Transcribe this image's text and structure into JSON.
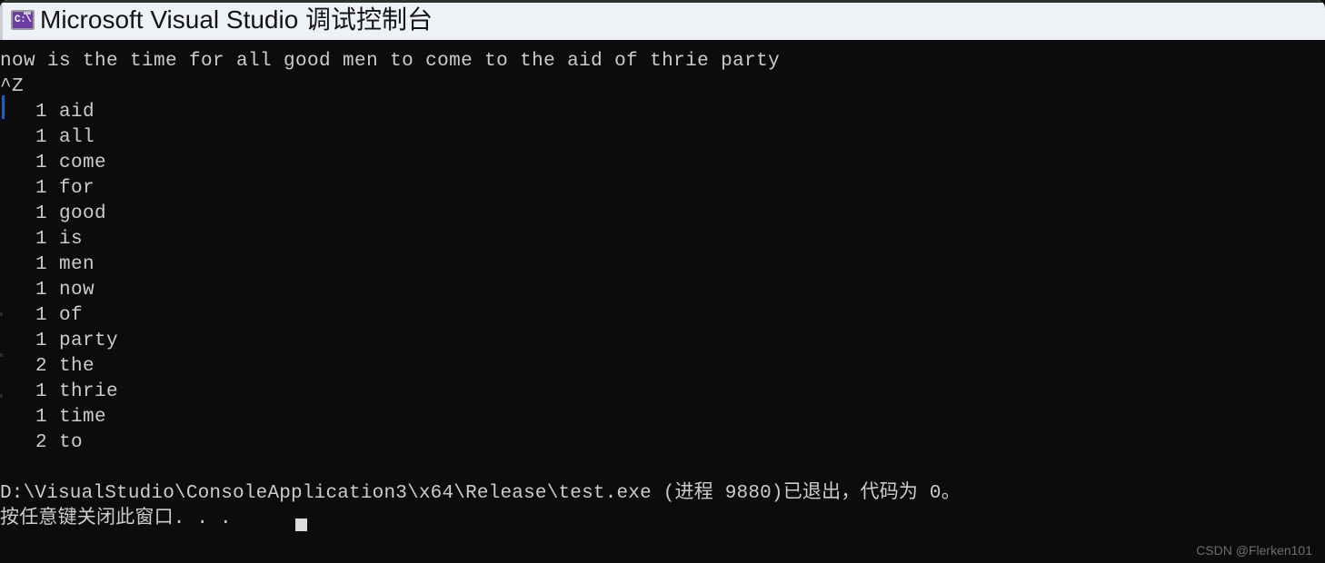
{
  "window": {
    "title": "Microsoft Visual Studio 调试控制台",
    "icon_name": "console-app-icon",
    "icon_text": "C:\\",
    "titlebar_bg": "#eef2f6",
    "titlebar_text_color": "#141414"
  },
  "console": {
    "bg": "#0c0c0c",
    "text_color": "#cccccc",
    "scrollbar": {
      "thumb_color": "#1565c0",
      "track_color": "#0c0c0c"
    },
    "input_line": "now is the time for all good men to come to the aid of thrie party",
    "eof_marker": "^Z",
    "word_counts": [
      {
        "count": "1",
        "word": "aid"
      },
      {
        "count": "1",
        "word": "all"
      },
      {
        "count": "1",
        "word": "come"
      },
      {
        "count": "1",
        "word": "for"
      },
      {
        "count": "1",
        "word": "good"
      },
      {
        "count": "1",
        "word": "is"
      },
      {
        "count": "1",
        "word": "men"
      },
      {
        "count": "1",
        "word": "now"
      },
      {
        "count": "1",
        "word": "of"
      },
      {
        "count": "1",
        "word": "party"
      },
      {
        "count": "2",
        "word": "the"
      },
      {
        "count": "1",
        "word": "thrie"
      },
      {
        "count": "1",
        "word": "time"
      },
      {
        "count": "2",
        "word": "to"
      }
    ],
    "word_count_lines": [
      "   1 aid",
      "   1 all",
      "   1 come",
      "   1 for",
      "   1 good",
      "   1 is",
      "   1 men",
      "   1 now",
      "   1 of",
      "   1 party",
      "   2 the",
      "   1 thrie",
      "   1 time",
      "   2 to"
    ],
    "exit_line": "D:\\VisualStudio\\ConsoleApplication3\\x64\\Release\\test.exe (进程 9880)已退出，代码为 0。",
    "exit_details": {
      "exe_path": "D:\\VisualStudio\\ConsoleApplication3\\x64\\Release\\test.exe",
      "process_id": "9880",
      "exit_code": "0"
    },
    "prompt_line": "按任意键关闭此窗口. . ."
  },
  "watermark": {
    "text": "CSDN @Flerken101"
  }
}
